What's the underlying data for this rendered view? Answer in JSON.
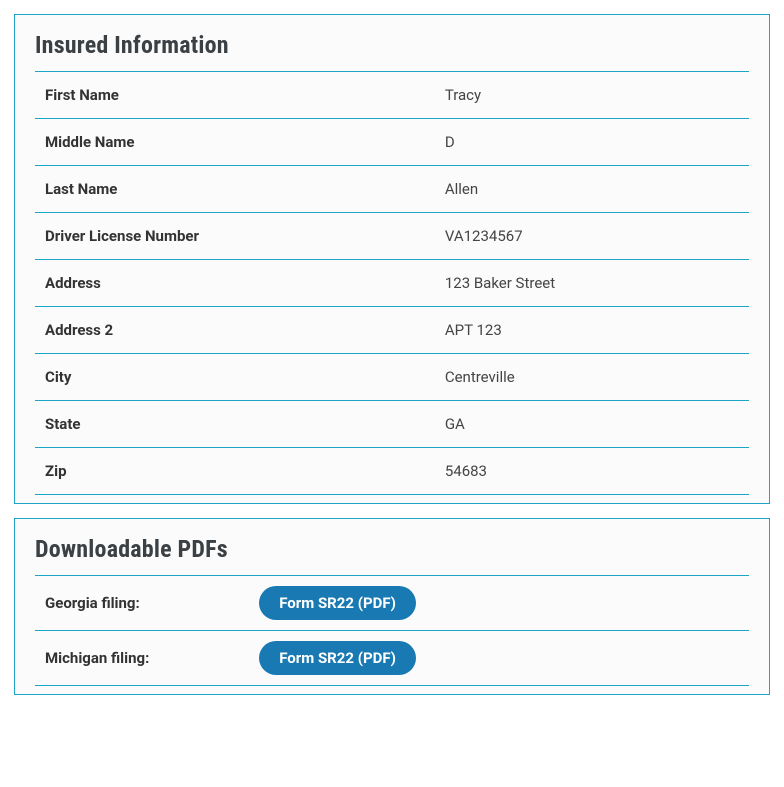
{
  "insured": {
    "title": "Insured Information",
    "rows": [
      {
        "label": "First Name",
        "value": "Tracy"
      },
      {
        "label": "Middle Name",
        "value": "D"
      },
      {
        "label": "Last Name",
        "value": "Allen"
      },
      {
        "label": "Driver License Number",
        "value": "VA1234567"
      },
      {
        "label": "Address",
        "value": "123 Baker Street"
      },
      {
        "label": "Address 2",
        "value": "APT 123"
      },
      {
        "label": "City",
        "value": "Centreville"
      },
      {
        "label": "State",
        "value": "GA"
      },
      {
        "label": "Zip",
        "value": "54683"
      }
    ]
  },
  "pdfs": {
    "title": "Downloadable PDFs",
    "rows": [
      {
        "label": "Georgia filing:",
        "button": "Form SR22 (PDF)"
      },
      {
        "label": "Michigan filing:",
        "button": "Form SR22 (PDF)"
      }
    ]
  }
}
